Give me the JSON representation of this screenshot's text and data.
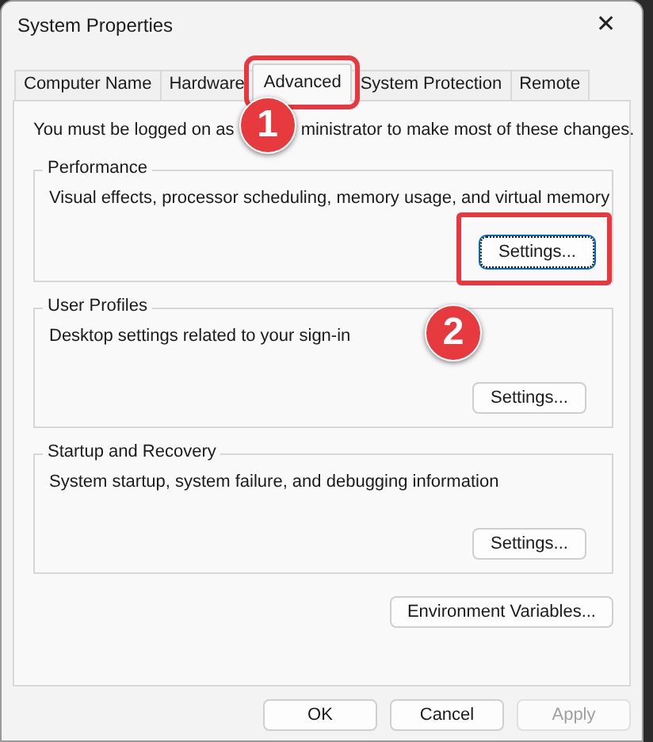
{
  "window": {
    "title": "System Properties",
    "close": "✕"
  },
  "tabs": [
    {
      "label": "Computer Name",
      "selected": false,
      "highlighted": false
    },
    {
      "label": "Hardware",
      "selected": false,
      "highlighted": false
    },
    {
      "label": "Advanced",
      "selected": true,
      "highlighted": true
    },
    {
      "label": "System Protection",
      "selected": false,
      "highlighted": false
    },
    {
      "label": "Remote",
      "selected": false,
      "highlighted": false
    }
  ],
  "notice": {
    "before": "You must be logged on as",
    "after": "ministrator to make most of these changes.",
    "callout": "1"
  },
  "groups": [
    {
      "title": "Performance",
      "description": "Visual effects, processor scheduling, memory usage, and virtual memory",
      "button": {
        "label": "Settings...",
        "focused": true,
        "highlighted": true
      },
      "callout": "2"
    },
    {
      "title": "User Profiles",
      "description": "Desktop settings related to your sign-in",
      "button": {
        "label": "Settings...",
        "focused": false,
        "highlighted": false
      }
    },
    {
      "title": "Startup and Recovery",
      "description": "System startup, system failure, and debugging information",
      "button": {
        "label": "Settings...",
        "focused": false,
        "highlighted": false
      }
    }
  ],
  "environment_button": {
    "label": "Environment Variables..."
  },
  "buttons": [
    {
      "label": "OK",
      "disabled": false
    },
    {
      "label": "Cancel",
      "disabled": false
    },
    {
      "label": "Apply",
      "disabled": true
    }
  ]
}
